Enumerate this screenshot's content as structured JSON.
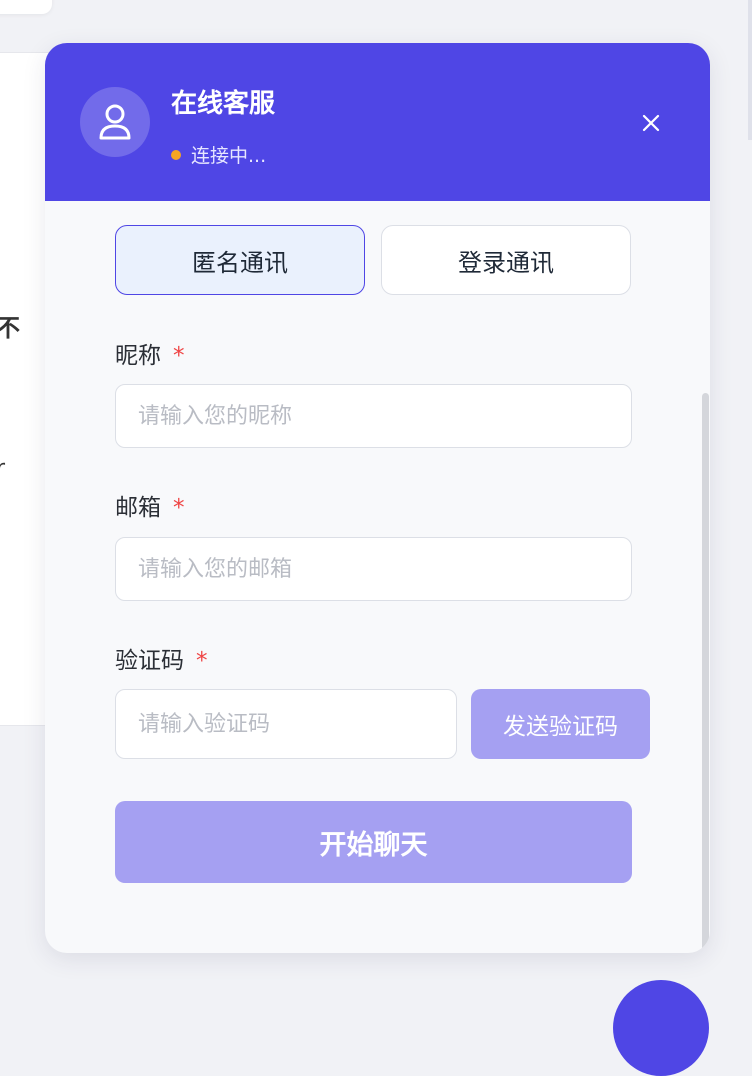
{
  "background": {
    "fragment_1": "不",
    "fragment_2": "r"
  },
  "chat_panel": {
    "header": {
      "title": "在线客服",
      "status": "连接中...",
      "status_color": "#f5a524",
      "avatar_icon": "user-icon",
      "close_icon": "close-icon",
      "brand_color": "#4f46e5"
    },
    "tabs": [
      {
        "label": "匿名通讯",
        "active": true
      },
      {
        "label": "登录通讯",
        "active": false
      }
    ],
    "form": {
      "nickname": {
        "label": "昵称",
        "required_mark": "*",
        "placeholder": "请输入您的昵称",
        "value": ""
      },
      "email": {
        "label": "邮箱",
        "required_mark": "*",
        "placeholder": "请输入您的邮箱",
        "value": ""
      },
      "code": {
        "label": "验证码",
        "required_mark": "*",
        "placeholder": "请输入验证码",
        "value": ""
      },
      "send_code_label": "发送验证码",
      "submit_label": "开始聊天"
    }
  }
}
